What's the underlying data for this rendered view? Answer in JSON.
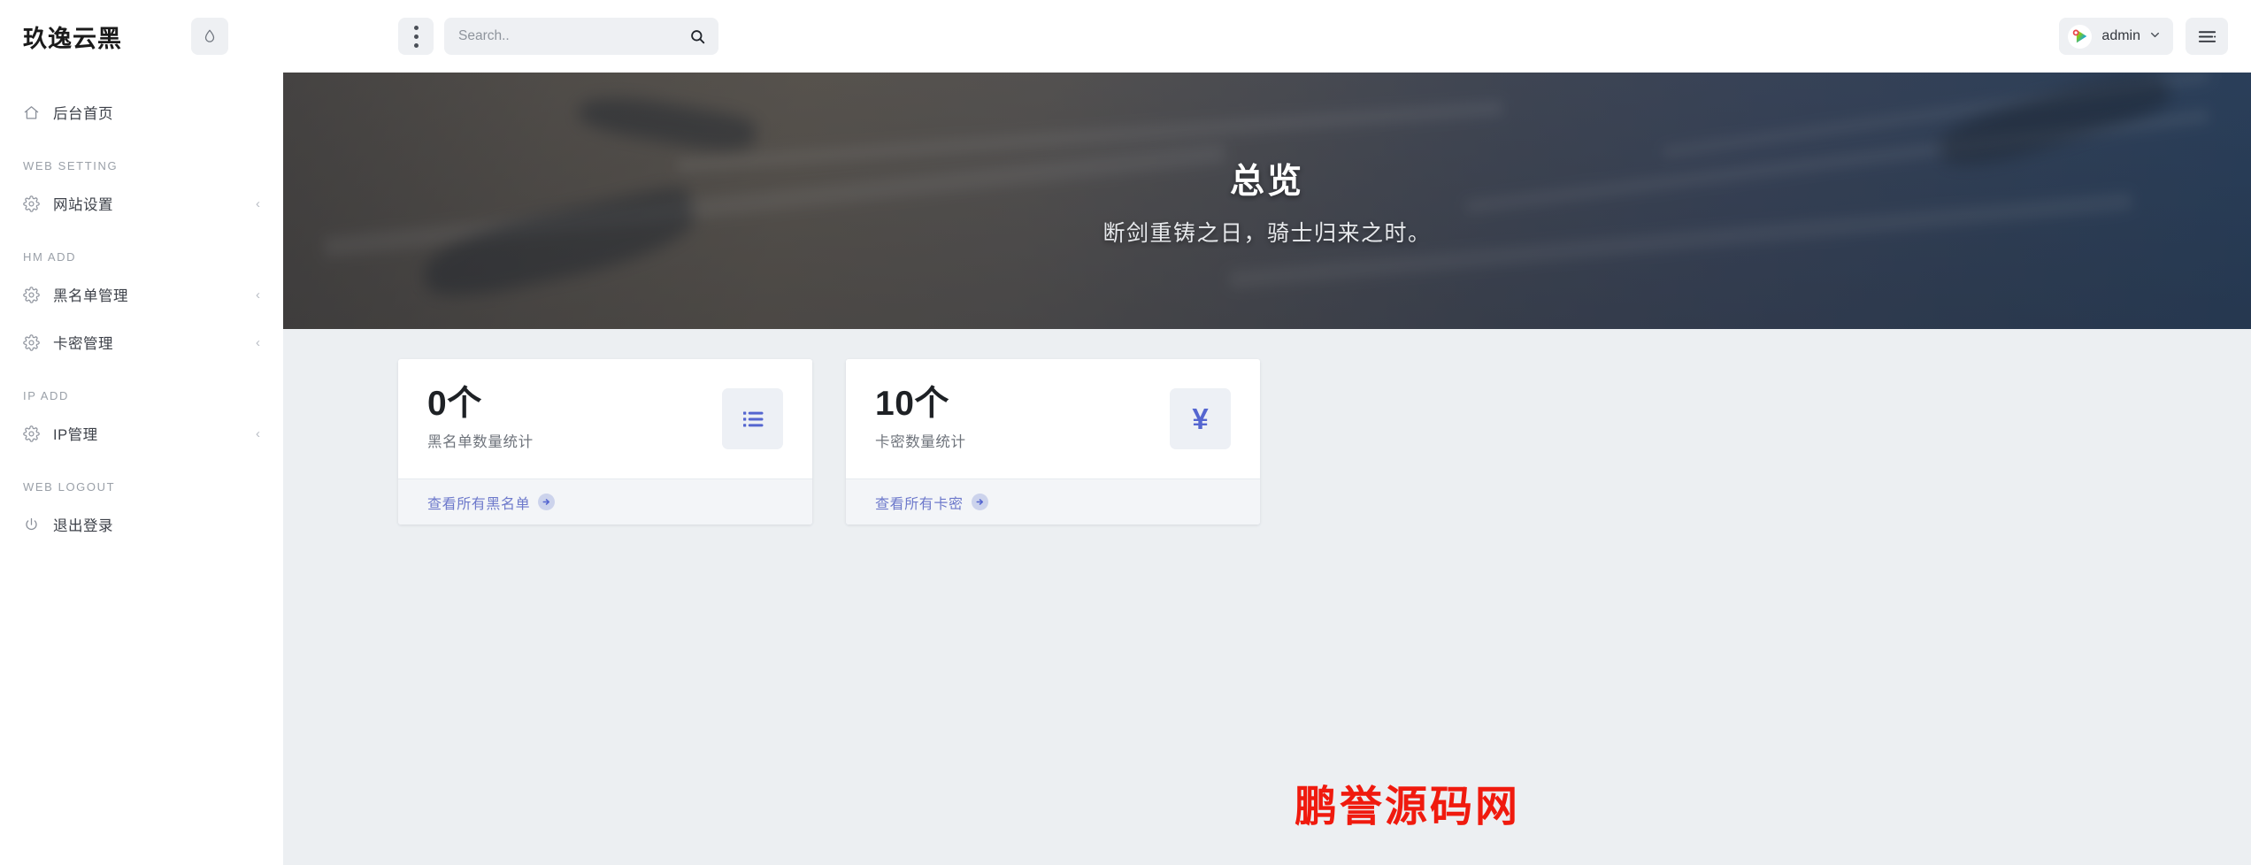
{
  "brand": {
    "title": "玖逸云黑",
    "drop_icon": "water-drop-icon"
  },
  "topbar": {
    "kebab_icon": "vertical-dots-icon",
    "search": {
      "placeholder": "Search..",
      "value": "",
      "icon": "search-icon"
    },
    "user": {
      "name": "admin",
      "caret": "▾",
      "avatar_icon": "user-avatar-icon"
    },
    "menu_icon": "list-menu-icon"
  },
  "sidebar": {
    "items": [
      {
        "type": "link",
        "label": "后台首页",
        "icon": "home-icon",
        "caret": ""
      },
      {
        "type": "section",
        "label": "WEB SETTING"
      },
      {
        "type": "link",
        "label": "网站设置",
        "icon": "gear-icon",
        "caret": "‹"
      },
      {
        "type": "section",
        "label": "HM ADD"
      },
      {
        "type": "link",
        "label": "黑名单管理",
        "icon": "gear-icon",
        "caret": "‹"
      },
      {
        "type": "link",
        "label": "卡密管理",
        "icon": "gear-icon",
        "caret": "‹"
      },
      {
        "type": "section",
        "label": "IP ADD"
      },
      {
        "type": "link",
        "label": "IP管理",
        "icon": "gear-icon",
        "caret": "‹"
      },
      {
        "type": "section",
        "label": "WEB LOGOUT"
      },
      {
        "type": "link",
        "label": "退出登录",
        "icon": "power-icon",
        "caret": ""
      }
    ]
  },
  "banner": {
    "title": "总览",
    "subtitle": "断剑重铸之日，骑士归来之时。"
  },
  "cards": [
    {
      "number": "0个",
      "description": "黑名单数量统计",
      "icon": "list-icon",
      "link_label": "查看所有黑名单",
      "link_icon": "arrow-right-circle-icon"
    },
    {
      "number": "10个",
      "description": "卡密数量统计",
      "icon": "yen-icon",
      "icon_glyph": "¥",
      "link_label": "查看所有卡密",
      "link_icon": "arrow-right-circle-icon"
    }
  ],
  "watermark": {
    "text": "鹏誉源码网",
    "color": "#f01a0e"
  },
  "colors": {
    "accent": "#5566d0",
    "link": "#6d79cb",
    "sidebar_bg": "#ffffff",
    "content_bg": "#eceff2",
    "chip_bg": "#eef0f3"
  }
}
